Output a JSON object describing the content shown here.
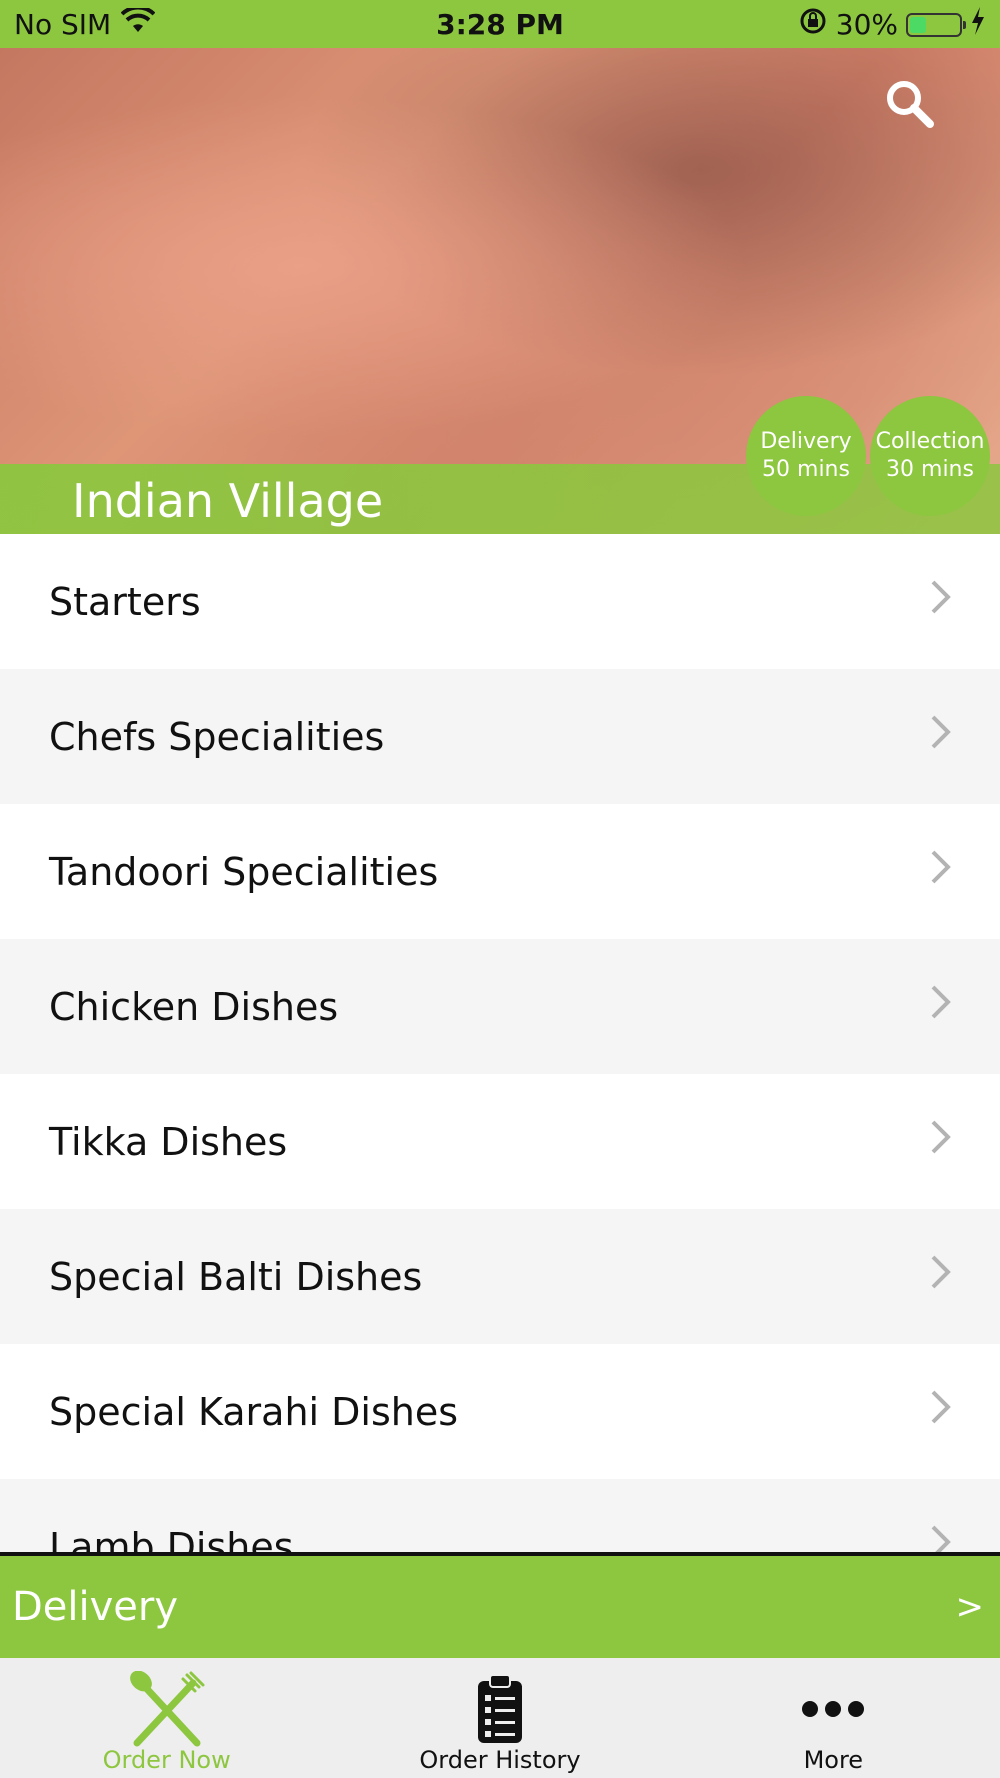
{
  "status_bar": {
    "carrier": "No SIM",
    "time": "3:28 PM",
    "battery_text": "30%",
    "battery_level": 0.3,
    "icons": [
      "wifi-icon",
      "orientation-lock-icon",
      "battery-icon",
      "charging-bolt-icon"
    ]
  },
  "header": {
    "restaurant_name": "Indian Village",
    "search_icon": "search-icon",
    "badges": {
      "delivery": {
        "label": "Delivery",
        "time": "50 mins"
      },
      "collection": {
        "label": "Collection",
        "time": "30 mins"
      }
    }
  },
  "menu": {
    "items": [
      {
        "label": "Starters"
      },
      {
        "label": "Chefs Specialities"
      },
      {
        "label": "Tandoori Specialities"
      },
      {
        "label": "Chicken Dishes"
      },
      {
        "label": "Tikka Dishes"
      },
      {
        "label": "Special Balti Dishes"
      },
      {
        "label": "Special Karahi Dishes"
      },
      {
        "label": "Lamb Dishes"
      }
    ]
  },
  "delivery_bar": {
    "label": "Delivery",
    "arrow": ">"
  },
  "tabs": [
    {
      "label": "Order Now",
      "icon": "fork-knife-icon",
      "active": true
    },
    {
      "label": "Order History",
      "icon": "clipboard-list-icon",
      "active": false
    },
    {
      "label": "More",
      "icon": "more-dots-icon",
      "active": false
    }
  ],
  "colors": {
    "accent": "#8dc63f",
    "row_alt": "#f5f5f5",
    "tab_bar": "#eeeeee"
  }
}
